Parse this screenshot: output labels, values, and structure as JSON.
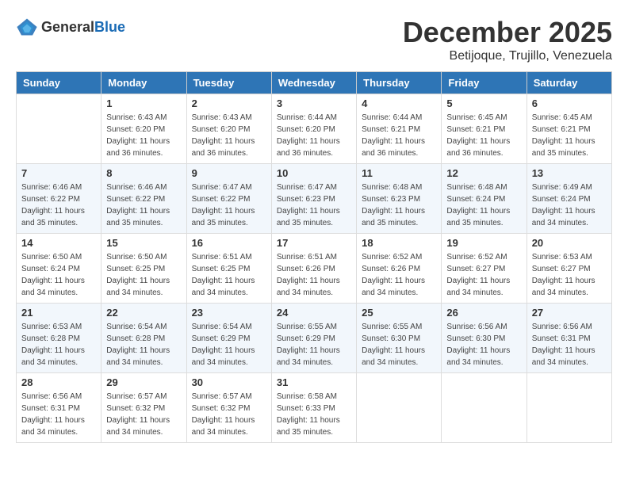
{
  "header": {
    "logo_general": "General",
    "logo_blue": "Blue",
    "month_year": "December 2025",
    "location": "Betijoque, Trujillo, Venezuela"
  },
  "days_of_week": [
    "Sunday",
    "Monday",
    "Tuesday",
    "Wednesday",
    "Thursday",
    "Friday",
    "Saturday"
  ],
  "weeks": [
    [
      {
        "day": "",
        "sunrise": "",
        "sunset": "",
        "daylight": ""
      },
      {
        "day": "1",
        "sunrise": "Sunrise: 6:43 AM",
        "sunset": "Sunset: 6:20 PM",
        "daylight": "Daylight: 11 hours and 36 minutes."
      },
      {
        "day": "2",
        "sunrise": "Sunrise: 6:43 AM",
        "sunset": "Sunset: 6:20 PM",
        "daylight": "Daylight: 11 hours and 36 minutes."
      },
      {
        "day": "3",
        "sunrise": "Sunrise: 6:44 AM",
        "sunset": "Sunset: 6:20 PM",
        "daylight": "Daylight: 11 hours and 36 minutes."
      },
      {
        "day": "4",
        "sunrise": "Sunrise: 6:44 AM",
        "sunset": "Sunset: 6:21 PM",
        "daylight": "Daylight: 11 hours and 36 minutes."
      },
      {
        "day": "5",
        "sunrise": "Sunrise: 6:45 AM",
        "sunset": "Sunset: 6:21 PM",
        "daylight": "Daylight: 11 hours and 36 minutes."
      },
      {
        "day": "6",
        "sunrise": "Sunrise: 6:45 AM",
        "sunset": "Sunset: 6:21 PM",
        "daylight": "Daylight: 11 hours and 35 minutes."
      }
    ],
    [
      {
        "day": "7",
        "sunrise": "Sunrise: 6:46 AM",
        "sunset": "Sunset: 6:22 PM",
        "daylight": "Daylight: 11 hours and 35 minutes."
      },
      {
        "day": "8",
        "sunrise": "Sunrise: 6:46 AM",
        "sunset": "Sunset: 6:22 PM",
        "daylight": "Daylight: 11 hours and 35 minutes."
      },
      {
        "day": "9",
        "sunrise": "Sunrise: 6:47 AM",
        "sunset": "Sunset: 6:22 PM",
        "daylight": "Daylight: 11 hours and 35 minutes."
      },
      {
        "day": "10",
        "sunrise": "Sunrise: 6:47 AM",
        "sunset": "Sunset: 6:23 PM",
        "daylight": "Daylight: 11 hours and 35 minutes."
      },
      {
        "day": "11",
        "sunrise": "Sunrise: 6:48 AM",
        "sunset": "Sunset: 6:23 PM",
        "daylight": "Daylight: 11 hours and 35 minutes."
      },
      {
        "day": "12",
        "sunrise": "Sunrise: 6:48 AM",
        "sunset": "Sunset: 6:24 PM",
        "daylight": "Daylight: 11 hours and 35 minutes."
      },
      {
        "day": "13",
        "sunrise": "Sunrise: 6:49 AM",
        "sunset": "Sunset: 6:24 PM",
        "daylight": "Daylight: 11 hours and 34 minutes."
      }
    ],
    [
      {
        "day": "14",
        "sunrise": "Sunrise: 6:50 AM",
        "sunset": "Sunset: 6:24 PM",
        "daylight": "Daylight: 11 hours and 34 minutes."
      },
      {
        "day": "15",
        "sunrise": "Sunrise: 6:50 AM",
        "sunset": "Sunset: 6:25 PM",
        "daylight": "Daylight: 11 hours and 34 minutes."
      },
      {
        "day": "16",
        "sunrise": "Sunrise: 6:51 AM",
        "sunset": "Sunset: 6:25 PM",
        "daylight": "Daylight: 11 hours and 34 minutes."
      },
      {
        "day": "17",
        "sunrise": "Sunrise: 6:51 AM",
        "sunset": "Sunset: 6:26 PM",
        "daylight": "Daylight: 11 hours and 34 minutes."
      },
      {
        "day": "18",
        "sunrise": "Sunrise: 6:52 AM",
        "sunset": "Sunset: 6:26 PM",
        "daylight": "Daylight: 11 hours and 34 minutes."
      },
      {
        "day": "19",
        "sunrise": "Sunrise: 6:52 AM",
        "sunset": "Sunset: 6:27 PM",
        "daylight": "Daylight: 11 hours and 34 minutes."
      },
      {
        "day": "20",
        "sunrise": "Sunrise: 6:53 AM",
        "sunset": "Sunset: 6:27 PM",
        "daylight": "Daylight: 11 hours and 34 minutes."
      }
    ],
    [
      {
        "day": "21",
        "sunrise": "Sunrise: 6:53 AM",
        "sunset": "Sunset: 6:28 PM",
        "daylight": "Daylight: 11 hours and 34 minutes."
      },
      {
        "day": "22",
        "sunrise": "Sunrise: 6:54 AM",
        "sunset": "Sunset: 6:28 PM",
        "daylight": "Daylight: 11 hours and 34 minutes."
      },
      {
        "day": "23",
        "sunrise": "Sunrise: 6:54 AM",
        "sunset": "Sunset: 6:29 PM",
        "daylight": "Daylight: 11 hours and 34 minutes."
      },
      {
        "day": "24",
        "sunrise": "Sunrise: 6:55 AM",
        "sunset": "Sunset: 6:29 PM",
        "daylight": "Daylight: 11 hours and 34 minutes."
      },
      {
        "day": "25",
        "sunrise": "Sunrise: 6:55 AM",
        "sunset": "Sunset: 6:30 PM",
        "daylight": "Daylight: 11 hours and 34 minutes."
      },
      {
        "day": "26",
        "sunrise": "Sunrise: 6:56 AM",
        "sunset": "Sunset: 6:30 PM",
        "daylight": "Daylight: 11 hours and 34 minutes."
      },
      {
        "day": "27",
        "sunrise": "Sunrise: 6:56 AM",
        "sunset": "Sunset: 6:31 PM",
        "daylight": "Daylight: 11 hours and 34 minutes."
      }
    ],
    [
      {
        "day": "28",
        "sunrise": "Sunrise: 6:56 AM",
        "sunset": "Sunset: 6:31 PM",
        "daylight": "Daylight: 11 hours and 34 minutes."
      },
      {
        "day": "29",
        "sunrise": "Sunrise: 6:57 AM",
        "sunset": "Sunset: 6:32 PM",
        "daylight": "Daylight: 11 hours and 34 minutes."
      },
      {
        "day": "30",
        "sunrise": "Sunrise: 6:57 AM",
        "sunset": "Sunset: 6:32 PM",
        "daylight": "Daylight: 11 hours and 34 minutes."
      },
      {
        "day": "31",
        "sunrise": "Sunrise: 6:58 AM",
        "sunset": "Sunset: 6:33 PM",
        "daylight": "Daylight: 11 hours and 35 minutes."
      },
      {
        "day": "",
        "sunrise": "",
        "sunset": "",
        "daylight": ""
      },
      {
        "day": "",
        "sunrise": "",
        "sunset": "",
        "daylight": ""
      },
      {
        "day": "",
        "sunrise": "",
        "sunset": "",
        "daylight": ""
      }
    ]
  ]
}
